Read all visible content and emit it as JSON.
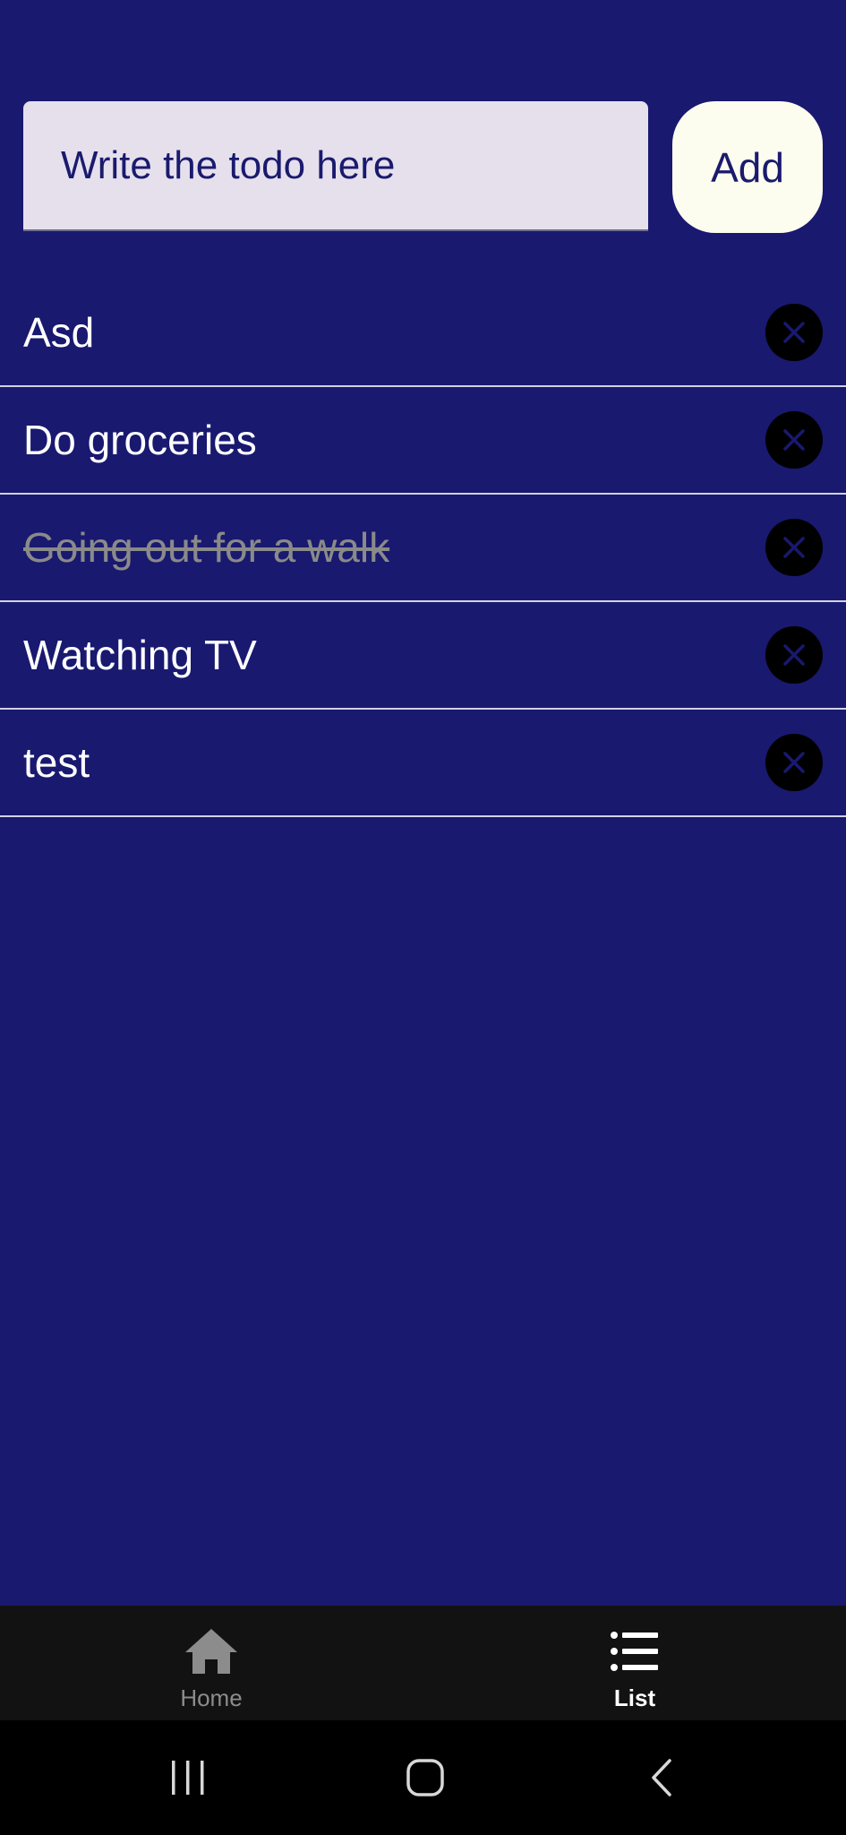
{
  "input": {
    "placeholder": "Write the todo here",
    "value": ""
  },
  "add_button": {
    "label": "Add"
  },
  "todos": [
    {
      "text": "Asd",
      "done": false
    },
    {
      "text": "Do groceries",
      "done": false
    },
    {
      "text": "Going out for a walk",
      "done": true
    },
    {
      "text": "Watching TV",
      "done": false
    },
    {
      "text": "test",
      "done": false
    }
  ],
  "bottom_nav": {
    "tabs": [
      {
        "label": "Home",
        "icon": "home-icon",
        "active": false
      },
      {
        "label": "List",
        "icon": "list-icon",
        "active": true
      }
    ]
  },
  "system_nav": {
    "buttons": [
      "recents-icon",
      "home-icon",
      "back-icon"
    ]
  },
  "colors": {
    "background": "#191970",
    "input_bg": "#e6e0ec",
    "add_button_bg": "#fdfdef",
    "nav_bg": "#121212",
    "text_primary": "#ffffff",
    "text_done": "#8a8a8a"
  }
}
